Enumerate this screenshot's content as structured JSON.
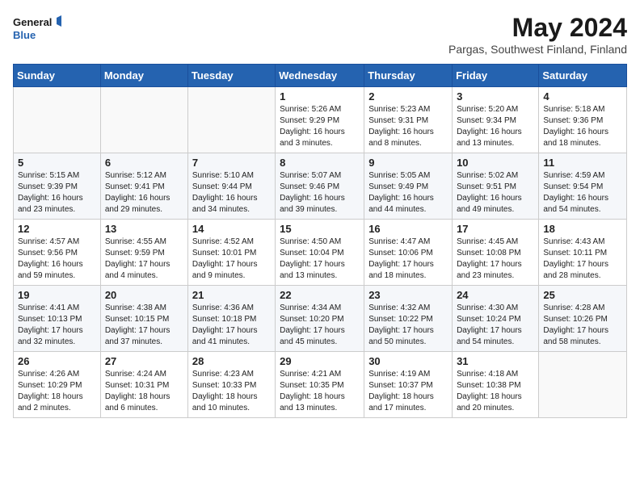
{
  "header": {
    "logo_general": "General",
    "logo_blue": "Blue",
    "title": "May 2024",
    "subtitle": "Pargas, Southwest Finland, Finland"
  },
  "days_of_week": [
    "Sunday",
    "Monday",
    "Tuesday",
    "Wednesday",
    "Thursday",
    "Friday",
    "Saturday"
  ],
  "weeks": [
    [
      {
        "day": "",
        "info": ""
      },
      {
        "day": "",
        "info": ""
      },
      {
        "day": "",
        "info": ""
      },
      {
        "day": "1",
        "info": "Sunrise: 5:26 AM\nSunset: 9:29 PM\nDaylight: 16 hours and 3 minutes."
      },
      {
        "day": "2",
        "info": "Sunrise: 5:23 AM\nSunset: 9:31 PM\nDaylight: 16 hours and 8 minutes."
      },
      {
        "day": "3",
        "info": "Sunrise: 5:20 AM\nSunset: 9:34 PM\nDaylight: 16 hours and 13 minutes."
      },
      {
        "day": "4",
        "info": "Sunrise: 5:18 AM\nSunset: 9:36 PM\nDaylight: 16 hours and 18 minutes."
      }
    ],
    [
      {
        "day": "5",
        "info": "Sunrise: 5:15 AM\nSunset: 9:39 PM\nDaylight: 16 hours and 23 minutes."
      },
      {
        "day": "6",
        "info": "Sunrise: 5:12 AM\nSunset: 9:41 PM\nDaylight: 16 hours and 29 minutes."
      },
      {
        "day": "7",
        "info": "Sunrise: 5:10 AM\nSunset: 9:44 PM\nDaylight: 16 hours and 34 minutes."
      },
      {
        "day": "8",
        "info": "Sunrise: 5:07 AM\nSunset: 9:46 PM\nDaylight: 16 hours and 39 minutes."
      },
      {
        "day": "9",
        "info": "Sunrise: 5:05 AM\nSunset: 9:49 PM\nDaylight: 16 hours and 44 minutes."
      },
      {
        "day": "10",
        "info": "Sunrise: 5:02 AM\nSunset: 9:51 PM\nDaylight: 16 hours and 49 minutes."
      },
      {
        "day": "11",
        "info": "Sunrise: 4:59 AM\nSunset: 9:54 PM\nDaylight: 16 hours and 54 minutes."
      }
    ],
    [
      {
        "day": "12",
        "info": "Sunrise: 4:57 AM\nSunset: 9:56 PM\nDaylight: 16 hours and 59 minutes."
      },
      {
        "day": "13",
        "info": "Sunrise: 4:55 AM\nSunset: 9:59 PM\nDaylight: 17 hours and 4 minutes."
      },
      {
        "day": "14",
        "info": "Sunrise: 4:52 AM\nSunset: 10:01 PM\nDaylight: 17 hours and 9 minutes."
      },
      {
        "day": "15",
        "info": "Sunrise: 4:50 AM\nSunset: 10:04 PM\nDaylight: 17 hours and 13 minutes."
      },
      {
        "day": "16",
        "info": "Sunrise: 4:47 AM\nSunset: 10:06 PM\nDaylight: 17 hours and 18 minutes."
      },
      {
        "day": "17",
        "info": "Sunrise: 4:45 AM\nSunset: 10:08 PM\nDaylight: 17 hours and 23 minutes."
      },
      {
        "day": "18",
        "info": "Sunrise: 4:43 AM\nSunset: 10:11 PM\nDaylight: 17 hours and 28 minutes."
      }
    ],
    [
      {
        "day": "19",
        "info": "Sunrise: 4:41 AM\nSunset: 10:13 PM\nDaylight: 17 hours and 32 minutes."
      },
      {
        "day": "20",
        "info": "Sunrise: 4:38 AM\nSunset: 10:15 PM\nDaylight: 17 hours and 37 minutes."
      },
      {
        "day": "21",
        "info": "Sunrise: 4:36 AM\nSunset: 10:18 PM\nDaylight: 17 hours and 41 minutes."
      },
      {
        "day": "22",
        "info": "Sunrise: 4:34 AM\nSunset: 10:20 PM\nDaylight: 17 hours and 45 minutes."
      },
      {
        "day": "23",
        "info": "Sunrise: 4:32 AM\nSunset: 10:22 PM\nDaylight: 17 hours and 50 minutes."
      },
      {
        "day": "24",
        "info": "Sunrise: 4:30 AM\nSunset: 10:24 PM\nDaylight: 17 hours and 54 minutes."
      },
      {
        "day": "25",
        "info": "Sunrise: 4:28 AM\nSunset: 10:26 PM\nDaylight: 17 hours and 58 minutes."
      }
    ],
    [
      {
        "day": "26",
        "info": "Sunrise: 4:26 AM\nSunset: 10:29 PM\nDaylight: 18 hours and 2 minutes."
      },
      {
        "day": "27",
        "info": "Sunrise: 4:24 AM\nSunset: 10:31 PM\nDaylight: 18 hours and 6 minutes."
      },
      {
        "day": "28",
        "info": "Sunrise: 4:23 AM\nSunset: 10:33 PM\nDaylight: 18 hours and 10 minutes."
      },
      {
        "day": "29",
        "info": "Sunrise: 4:21 AM\nSunset: 10:35 PM\nDaylight: 18 hours and 13 minutes."
      },
      {
        "day": "30",
        "info": "Sunrise: 4:19 AM\nSunset: 10:37 PM\nDaylight: 18 hours and 17 minutes."
      },
      {
        "day": "31",
        "info": "Sunrise: 4:18 AM\nSunset: 10:38 PM\nDaylight: 18 hours and 20 minutes."
      },
      {
        "day": "",
        "info": ""
      }
    ]
  ]
}
